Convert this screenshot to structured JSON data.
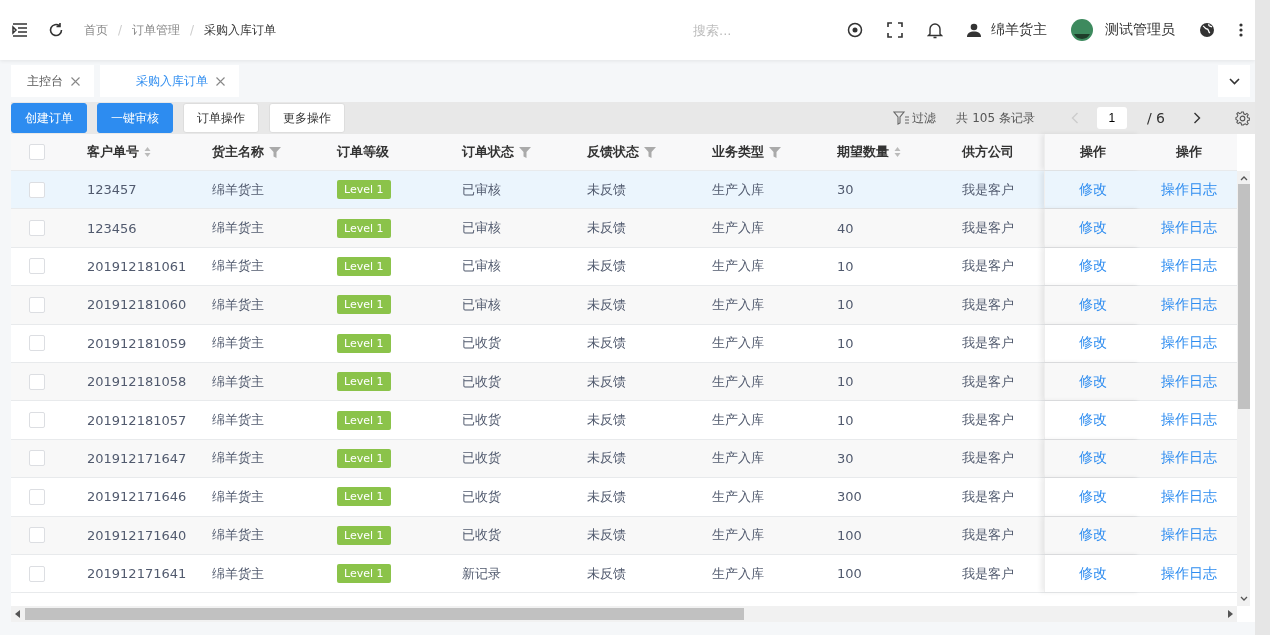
{
  "header": {
    "breadcrumb": [
      "首页",
      "订单管理",
      "采购入库订单"
    ],
    "separator": "/",
    "search": {
      "placeholder": "搜索..."
    },
    "user": "绵羊货主",
    "admin": "测试管理员"
  },
  "tabs": [
    {
      "label": "主控台",
      "selected": false
    },
    {
      "label": "采购入库订单",
      "selected": true
    }
  ],
  "toolbar": {
    "buttons": [
      {
        "label": "创建订单",
        "kind": "primary"
      },
      {
        "label": "一键审核",
        "kind": "primary"
      },
      {
        "label": "订单操作",
        "kind": "default"
      },
      {
        "label": "更多操作",
        "kind": "default"
      }
    ],
    "filter": "过滤",
    "total": "共 105 条记录",
    "page": "1",
    "pages": "/ 6"
  },
  "table": {
    "all_checked": false,
    "columns": [
      {
        "label": "客户单号",
        "kind": "sort"
      },
      {
        "label": "货主名称",
        "kind": "filter"
      },
      {
        "label": "订单等级",
        "kind": "plain"
      },
      {
        "label": "订单状态",
        "kind": "filter"
      },
      {
        "label": "反馈状态",
        "kind": "filter"
      },
      {
        "label": "业务类型",
        "kind": "filter"
      },
      {
        "label": "期望数量",
        "kind": "sort"
      },
      {
        "label": "供方公司",
        "kind": "plain"
      },
      {
        "label": "操作",
        "kind": "plain"
      },
      {
        "label": "操作",
        "kind": "plain"
      }
    ],
    "rows": [
      {
        "selected": true,
        "checked": false,
        "cells": [
          "123457",
          "绵羊货主",
          "Level 1",
          "已审核",
          "未反馈",
          "生产入库",
          "30",
          "我是客户",
          "修改",
          "操作日志"
        ]
      },
      {
        "selected": false,
        "checked": false,
        "cells": [
          "123456",
          "绵羊货主",
          "Level 1",
          "已审核",
          "未反馈",
          "生产入库",
          "40",
          "我是客户",
          "修改",
          "操作日志"
        ]
      },
      {
        "selected": false,
        "checked": false,
        "cells": [
          "201912181061",
          "绵羊货主",
          "Level 1",
          "已审核",
          "未反馈",
          "生产入库",
          "10",
          "我是客户",
          "修改",
          "操作日志"
        ]
      },
      {
        "selected": false,
        "checked": false,
        "cells": [
          "201912181060",
          "绵羊货主",
          "Level 1",
          "已审核",
          "未反馈",
          "生产入库",
          "10",
          "我是客户",
          "修改",
          "操作日志"
        ]
      },
      {
        "selected": false,
        "checked": false,
        "cells": [
          "201912181059",
          "绵羊货主",
          "Level 1",
          "已收货",
          "未反馈",
          "生产入库",
          "10",
          "我是客户",
          "修改",
          "操作日志"
        ]
      },
      {
        "selected": false,
        "checked": false,
        "cells": [
          "201912181058",
          "绵羊货主",
          "Level 1",
          "已收货",
          "未反馈",
          "生产入库",
          "10",
          "我是客户",
          "修改",
          "操作日志"
        ]
      },
      {
        "selected": false,
        "checked": false,
        "cells": [
          "201912181057",
          "绵羊货主",
          "Level 1",
          "已收货",
          "未反馈",
          "生产入库",
          "10",
          "我是客户",
          "修改",
          "操作日志"
        ]
      },
      {
        "selected": false,
        "checked": false,
        "cells": [
          "201912171647",
          "绵羊货主",
          "Level 1",
          "已收货",
          "未反馈",
          "生产入库",
          "30",
          "我是客户",
          "修改",
          "操作日志"
        ]
      },
      {
        "selected": false,
        "checked": false,
        "cells": [
          "201912171646",
          "绵羊货主",
          "Level 1",
          "已收货",
          "未反馈",
          "生产入库",
          "300",
          "我是客户",
          "修改",
          "操作日志"
        ]
      },
      {
        "selected": false,
        "checked": false,
        "cells": [
          "201912171640",
          "绵羊货主",
          "Level 1",
          "已收货",
          "未反馈",
          "生产入库",
          "100",
          "我是客户",
          "修改",
          "操作日志"
        ]
      },
      {
        "selected": false,
        "checked": false,
        "cells": [
          "201912171641",
          "绵羊货主",
          "Level 1",
          "新记录",
          "未反馈",
          "生产入库",
          "100",
          "我是客户",
          "修改",
          "操作日志"
        ]
      }
    ]
  }
}
